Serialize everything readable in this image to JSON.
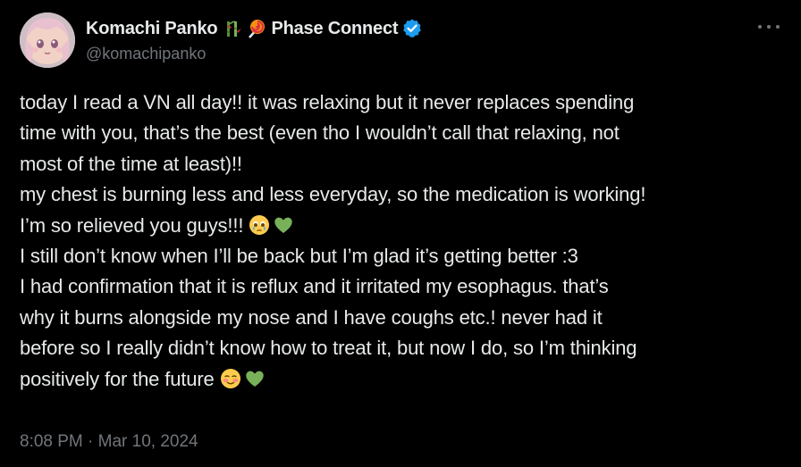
{
  "author": {
    "display_name": "Komachi Panko",
    "affiliation": "Phase Connect",
    "handle": "@komachipanko",
    "verified": true,
    "name_emojis": [
      "bamboo-emoji",
      "lollipop-emoji"
    ],
    "verified_color": "#1d9bf0"
  },
  "tweet": {
    "lines": [
      "today I read a VN all day!! it was relaxing but it never replaces spending",
      "time with you, that’s the best (even tho I wouldn’t call that relaxing, not",
      "most of the time at least)!!",
      "my chest is burning less and less everyday, so the medication is working!",
      "I’m so relieved you guys!!!",
      "I still don’t know when I’ll be back but I’m glad it’s getting better :3",
      "I had confirmation that it is reflux and it irritated my esophagus. that’s",
      "why it burns alongside my nose and I have coughs etc.! never had it",
      "before so I really didn’t know how to treat it, but now I do, so I’m thinking",
      "positively for the future"
    ],
    "line5_emojis": [
      "teary-face-emoji",
      "green-heart-emoji"
    ],
    "line10_emojis": [
      "smiling-blush-emoji",
      "green-heart-emoji"
    ],
    "timestamp": "8:08 PM · Mar 10, 2024"
  },
  "colors": {
    "background": "#000000",
    "text": "#e7e9ea",
    "muted": "#71767b",
    "accent": "#1d9bf0",
    "heart": "#78b159"
  }
}
